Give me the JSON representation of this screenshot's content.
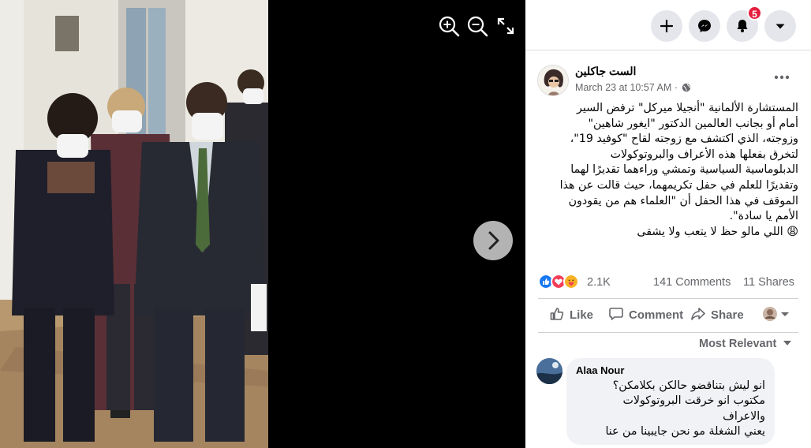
{
  "viewer": {
    "photo_description": "Photo of people in face masks walking down a hallway",
    "zoom_in_icon": "zoom-in-icon",
    "zoom_out_icon": "zoom-out-icon",
    "fullscreen_icon": "fullscreen-icon",
    "next_icon": "chevron-right-icon"
  },
  "topbar": {
    "icons": [
      "plus-icon",
      "messenger-icon",
      "bell-icon",
      "caret-down-icon"
    ],
    "notification_count": "5"
  },
  "post": {
    "author": "الست جاكلين",
    "timestamp": "March 23 at 10:57 AM",
    "separator": "·",
    "privacy_icon": "globe-icon",
    "more_label": "•••",
    "text_lines": [
      "المستشارة الألمانية \"أنجيلا ميركل\" ترفض السير",
      "أمام أو بجانب العالمين الدكتور \"ايغور شاهين\"",
      "وزوجته، الذي اكتشف مع زوجته لقاح \"كوفيد 19\"،",
      "لتخرق بفعلها هذه الأعراف والبروتوكولات",
      "الدبلوماسية السياسية وتمشي وراءهما تقديرًا لهما",
      "وتقديرًا للعلم في حفل تكريمهما، حيث قالت عن هذا",
      "الموقف في هذا الحفل أن \"العلماء هم من يقودون",
      "الأمم يا سادة\".",
      "😩 اللي مالو حظ لا يتعب ولا يشقى"
    ],
    "reaction_count": "2.1K",
    "comments_count": "141 Comments",
    "shares_count": "11 Shares",
    "reactions": [
      "like",
      "love",
      "care"
    ]
  },
  "actions": {
    "like_label": "Like",
    "comment_label": "Comment",
    "share_label": "Share"
  },
  "comments": {
    "sort_label": "Most Relevant",
    "items": [
      {
        "author": "Alaa Nour",
        "lines": [
          "انو ليش بتناقضو حالكن بكلامكن؟",
          "مكتوب انو خرقت البروتوكولات",
          "والاعراف",
          "يعني الشغلة مو نحن جايبينا من عنا"
        ]
      }
    ]
  },
  "colors": {
    "panel_bg": "#ffffff",
    "text_primary": "#050505",
    "text_secondary": "#65676b",
    "badge": "#e41e3f",
    "like_blue": "#1877f2",
    "love_red": "#f33e58",
    "care_yellow": "#f7b125"
  }
}
